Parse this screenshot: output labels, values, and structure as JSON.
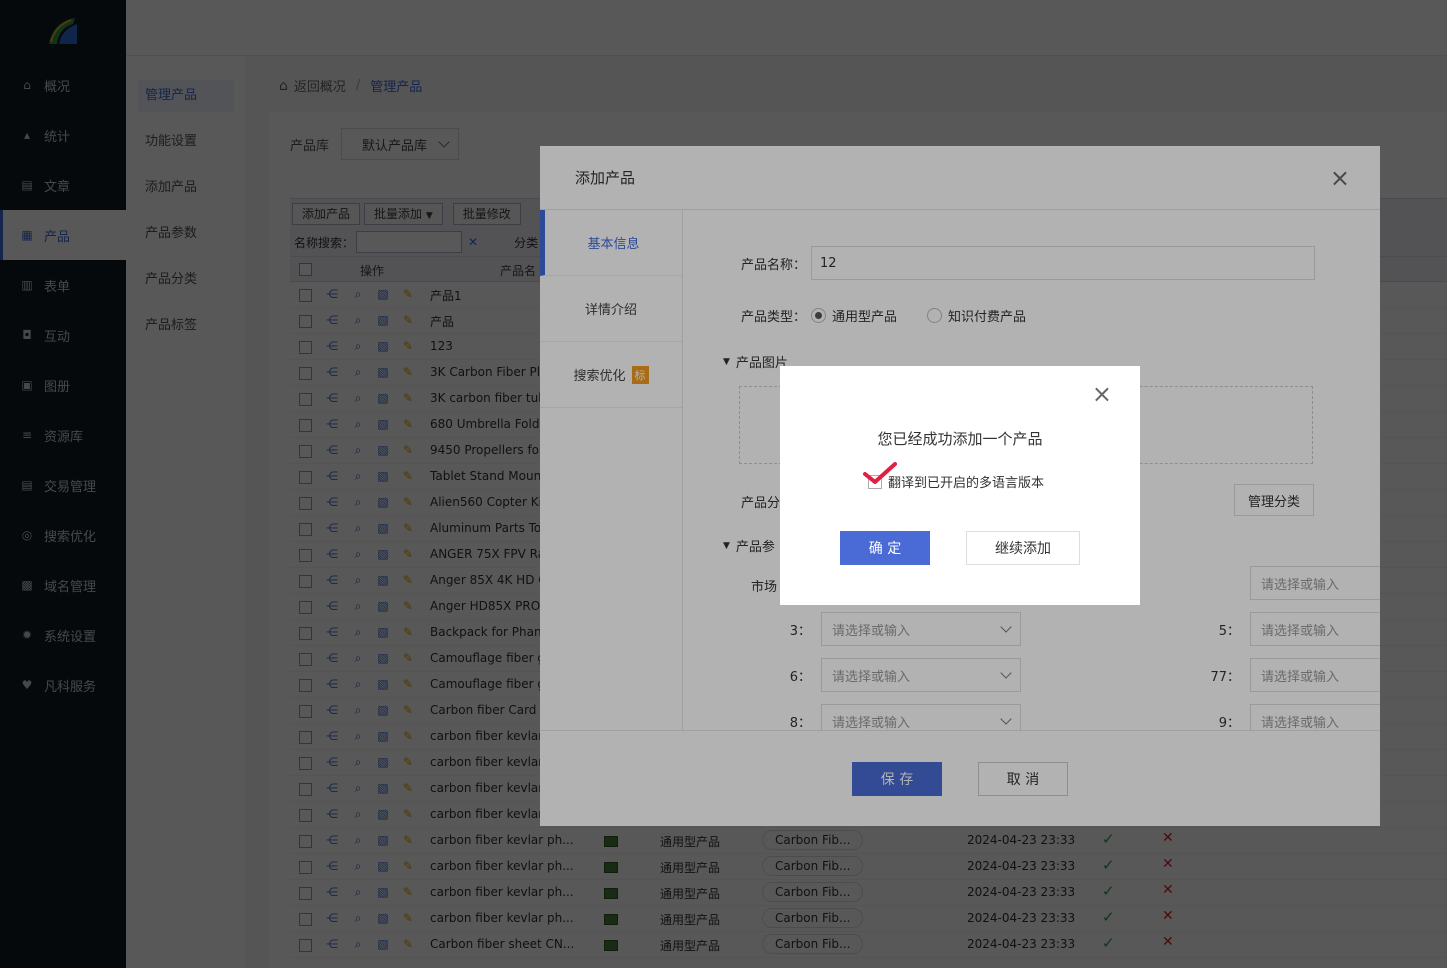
{
  "nav": {
    "items": [
      {
        "label": "概况",
        "icon": "home-icon",
        "glyph": "⌂"
      },
      {
        "label": "统计",
        "icon": "chart-icon",
        "glyph": "▴"
      },
      {
        "label": "文章",
        "icon": "article-icon",
        "glyph": "▤"
      },
      {
        "label": "产品",
        "icon": "product-icon",
        "glyph": "▦"
      },
      {
        "label": "表单",
        "icon": "form-icon",
        "glyph": "▥"
      },
      {
        "label": "互动",
        "icon": "chat-icon",
        "glyph": "◘"
      },
      {
        "label": "图册",
        "icon": "album-icon",
        "glyph": "▣"
      },
      {
        "label": "资源库",
        "icon": "database-icon",
        "glyph": "≡"
      },
      {
        "label": "交易管理",
        "icon": "trade-icon",
        "glyph": "▤"
      },
      {
        "label": "搜索优化",
        "icon": "seo-icon",
        "glyph": "◎"
      },
      {
        "label": "域名管理",
        "icon": "domain-icon",
        "glyph": "▩"
      },
      {
        "label": "系统设置",
        "icon": "gear-icon",
        "glyph": "✹"
      },
      {
        "label": "凡科服务",
        "icon": "heart-icon",
        "glyph": "♥"
      }
    ],
    "active": "产品"
  },
  "subnav": {
    "items": [
      "管理产品",
      "功能设置",
      "添加产品",
      "产品参数",
      "产品分类",
      "产品标签"
    ],
    "active": "管理产品"
  },
  "breadcrumb": {
    "back": "返回概况",
    "sep": "/",
    "current": "管理产品"
  },
  "library": {
    "label": "产品库",
    "value": "默认产品库"
  },
  "toolbar": {
    "add": "添加产品",
    "batch_add": "批量添加",
    "batch_edit": "批量修改"
  },
  "search": {
    "label": "名称搜索：",
    "category_label": "分类："
  },
  "grid": {
    "col_ops": "操作",
    "col_name": "产品名",
    "rows": [
      {
        "name": "产品1"
      },
      {
        "name": "产品"
      },
      {
        "name": "123"
      },
      {
        "name": "3K Carbon Fiber Pl"
      },
      {
        "name": "3K carbon fiber tub"
      },
      {
        "name": "680 Umbrella Foldi"
      },
      {
        "name": "9450 Propellers for"
      },
      {
        "name": "Tablet Stand Moun"
      },
      {
        "name": "Alien560 Copter Ki"
      },
      {
        "name": "Aluminum Parts To"
      },
      {
        "name": "ANGER 75X FPV Ra"
      },
      {
        "name": "Anger 85X 4K HD C"
      },
      {
        "name": "Anger HD85X PRO"
      },
      {
        "name": "Backpack for Phant"
      },
      {
        "name": "Camouflage fiber g"
      },
      {
        "name": "Camouflage fiber g"
      },
      {
        "name": "Carbon fiber Card l"
      },
      {
        "name": "carbon fiber kevlar"
      },
      {
        "name": "carbon fiber kevlar"
      },
      {
        "name": "carbon fiber kevlar"
      },
      {
        "name": "carbon fiber kevlar"
      },
      {
        "name": "carbon fiber kevlar ph...",
        "type": "通用型产品",
        "category": "Carbon Fib...",
        "date": "2024-04-23 23:33",
        "ok": "✓",
        "no": "✕"
      },
      {
        "name": "carbon fiber kevlar ph...",
        "type": "通用型产品",
        "category": "Carbon Fib...",
        "date": "2024-04-23 23:33",
        "ok": "✓",
        "no": "✕"
      },
      {
        "name": "carbon fiber kevlar ph...",
        "type": "通用型产品",
        "category": "Carbon Fib...",
        "date": "2024-04-23 23:33",
        "ok": "✓",
        "no": "✕"
      },
      {
        "name": "carbon fiber kevlar ph...",
        "type": "通用型产品",
        "category": "Carbon Fib...",
        "date": "2024-04-23 23:33",
        "ok": "✓",
        "no": "✕"
      },
      {
        "name": "Carbon fiber sheet CN...",
        "type": "通用型产品",
        "category": "Carbon Fib...",
        "date": "2024-04-23 23:33",
        "ok": "✓",
        "no": "✕"
      }
    ]
  },
  "modal": {
    "title": "添加产品",
    "close": "×",
    "tabs": [
      "基本信息",
      "详情介绍",
      "搜索优化"
    ],
    "tab_badge": "标",
    "name_label": "产品名称：",
    "name_value": "12",
    "type_label": "产品类型：",
    "type_options": [
      "通用型产品",
      "知识付费产品"
    ],
    "images_label": "产品图片",
    "category_label": "产品分",
    "manage_category": "管理分类",
    "params_label": "产品参",
    "market_label": "市场",
    "param_placeholder": "请选择或输入",
    "params": [
      {
        "label": "3：",
        "right_label": "5："
      },
      {
        "label": "6：",
        "right_label": "77："
      },
      {
        "label": "8：",
        "right_label": "9："
      }
    ],
    "save": "保 存",
    "cancel": "取 消"
  },
  "dialog": {
    "close": "×",
    "title": "您已经成功添加一个产品",
    "checkbox_label": "翻译到已开启的多语言版本",
    "confirm": "确 定",
    "continue": "继续添加"
  },
  "colors": {
    "accent": "#3f6ad8",
    "nav_bg": "#151b25",
    "primary_btn": "#4a6bd6",
    "check_mark": "#e02040"
  }
}
